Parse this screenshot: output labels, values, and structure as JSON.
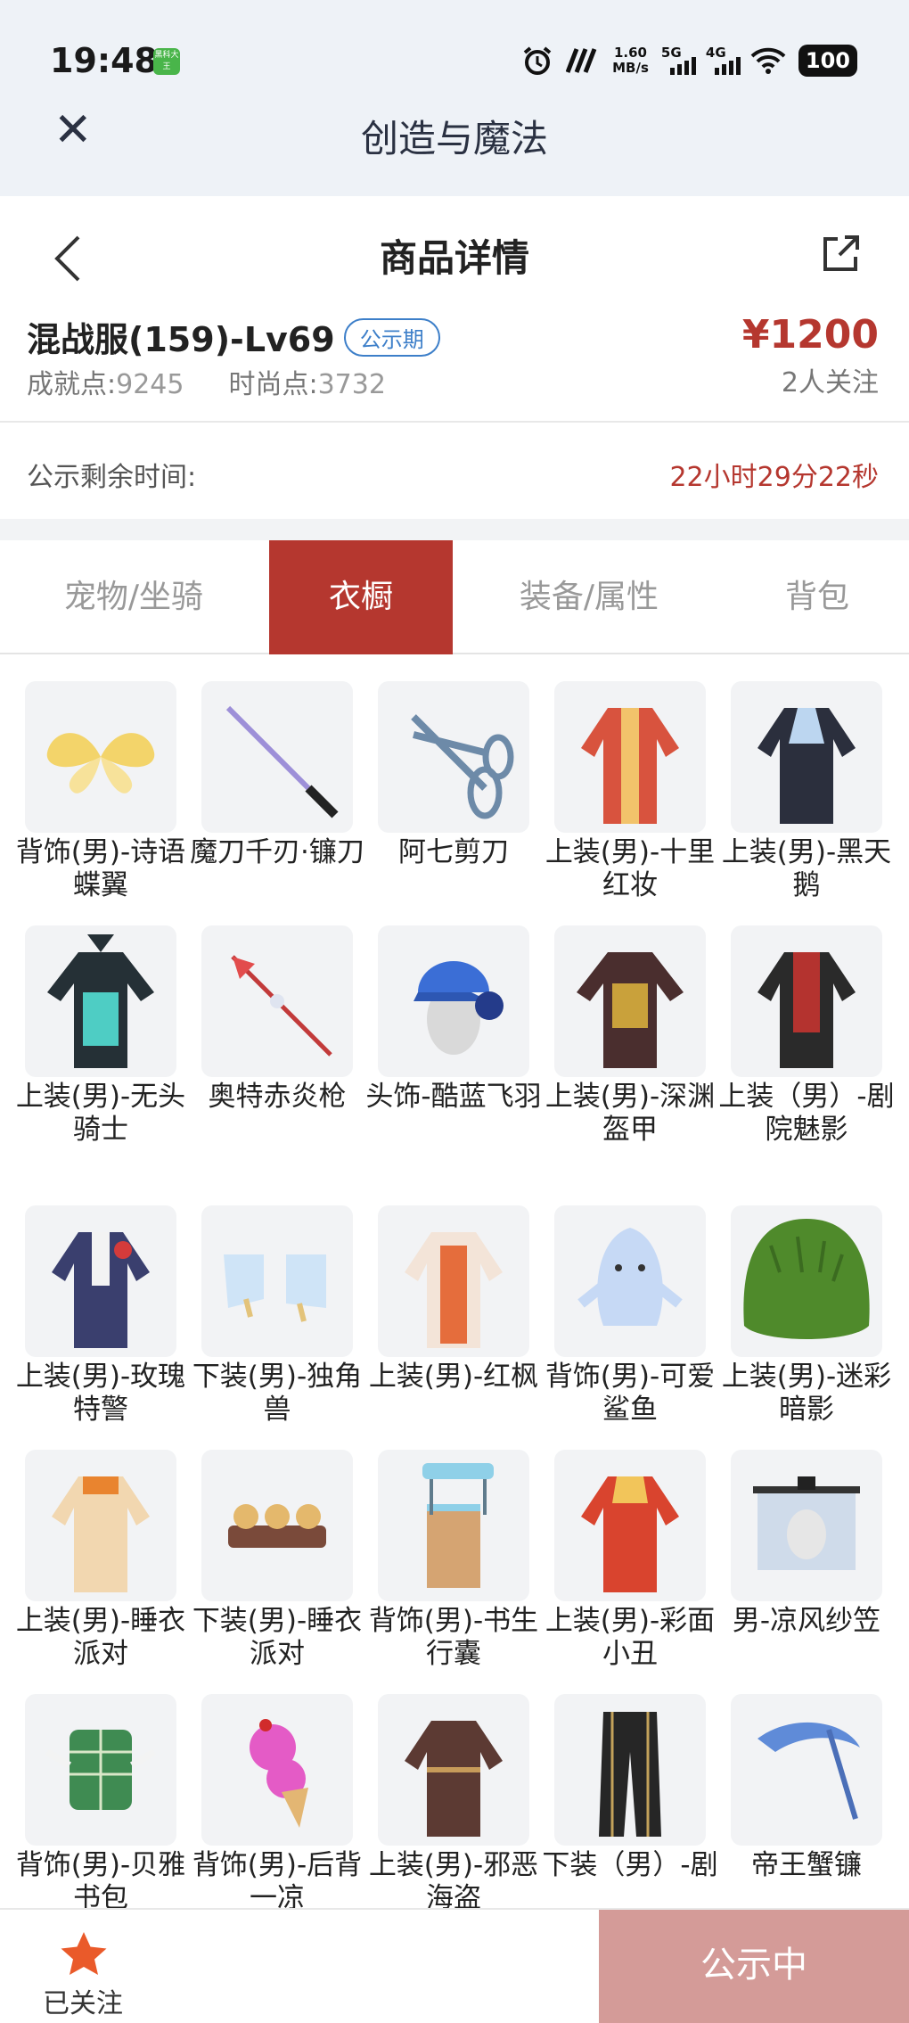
{
  "status_bar": {
    "time": "19:48",
    "app_badge": "黑科大王",
    "speed_top": "1.60",
    "speed_bottom": "MB/s",
    "net1": "5G",
    "net2": "4G",
    "battery": "100"
  },
  "app_bar": {
    "title": "创造与魔法",
    "close_icon": "close-icon"
  },
  "header": {
    "title": "商品详情",
    "back_icon": "back-arrow-icon",
    "share_icon": "share-icon"
  },
  "product": {
    "name": "混战服(159)-Lv69",
    "badge": "公示期",
    "achievement_label": "成就点:",
    "achievement_value": "9245",
    "fashion_label": "时尚点:",
    "fashion_value": "3732",
    "price": "¥1200",
    "followers": "2人关注",
    "colors": {
      "price": "#b5372f",
      "badge": "#3d7fc9"
    }
  },
  "countdown": {
    "label": "公示剩余时间:",
    "value": "22小时29分22秒"
  },
  "tabs": [
    {
      "label": "宠物/坐骑",
      "active": false
    },
    {
      "label": "衣橱",
      "active": true
    },
    {
      "label": "装备/属性",
      "active": false
    },
    {
      "label": "背包",
      "active": false
    }
  ],
  "items": [
    {
      "name": "背饰(男)-诗语蝶翼",
      "icon": "butterfly-wings-icon"
    },
    {
      "name": "魔刀千刃·镰刀",
      "icon": "katana-icon"
    },
    {
      "name": "阿七剪刀",
      "icon": "scissors-icon"
    },
    {
      "name": "上装(男)-十里红妆",
      "icon": "red-robe-icon"
    },
    {
      "name": "上装(男)-黑天鹅",
      "icon": "black-coat-icon"
    },
    {
      "name": "上装(男)-无头骑士",
      "icon": "armor-icon"
    },
    {
      "name": "奥特赤炎枪",
      "icon": "spear-icon"
    },
    {
      "name": "头饰-酷蓝飞羽",
      "icon": "cap-icon"
    },
    {
      "name": "上装(男)-深渊盔甲",
      "icon": "dark-armor-icon"
    },
    {
      "name": "上装（男）-剧院魅影",
      "icon": "vest-icon"
    },
    {
      "name": "上装(男)-玫瑰特警",
      "icon": "uniform-icon"
    },
    {
      "name": "下装(男)-独角兽",
      "icon": "boots-icon"
    },
    {
      "name": "上装(男)-红枫",
      "icon": "maple-robe-icon"
    },
    {
      "name": "背饰(男)-可爱鲨鱼",
      "icon": "shark-icon"
    },
    {
      "name": "上装(男)-迷彩暗影",
      "icon": "ghillie-icon"
    },
    {
      "name": "上装(男)-睡衣派对",
      "icon": "pajama-icon"
    },
    {
      "name": "下装(男)-睡衣派对",
      "icon": "slippers-icon"
    },
    {
      "name": "背饰(男)-书生行囊",
      "icon": "book-box-icon"
    },
    {
      "name": "上装(男)-彩面小丑",
      "icon": "clown-icon"
    },
    {
      "name": "男-凉风纱笠",
      "icon": "veil-hat-icon"
    },
    {
      "name": "背饰(男)-贝雅书包",
      "icon": "backpack-icon"
    },
    {
      "name": "背饰(男)-后背一凉",
      "icon": "icecream-icon"
    },
    {
      "name": "上装(男)-邪恶海盗",
      "icon": "pirate-coat-icon"
    },
    {
      "name": "下装（男）-剧",
      "icon": "pants-icon"
    },
    {
      "name": "帝王蟹镰",
      "icon": "scythe-icon"
    }
  ],
  "bottom_bar": {
    "follow_label": "已关注",
    "follow_icon": "star-icon",
    "status_button": "公示中"
  }
}
